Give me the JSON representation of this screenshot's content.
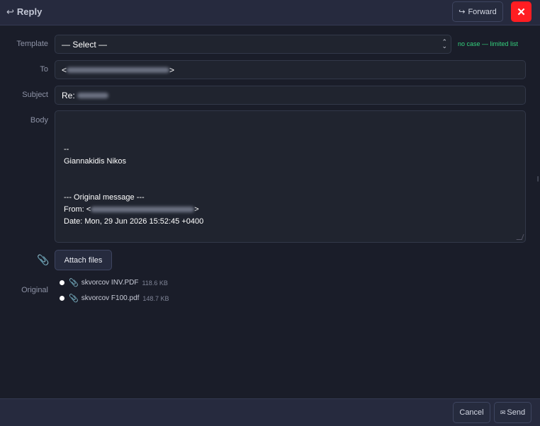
{
  "header": {
    "title": "Reply",
    "reply_icon": "↩",
    "forward_label": "Forward",
    "forward_icon": "↪",
    "close_icon": "✕"
  },
  "form": {
    "template": {
      "label": "Template",
      "value": "— Select —",
      "hint": "no case — limited list"
    },
    "to": {
      "label": "To",
      "prefix": "<",
      "suffix": ">"
    },
    "subject": {
      "label": "Subject",
      "prefix": "Re:"
    },
    "body": {
      "label": "Body",
      "signature_sep": "--",
      "signature_name": "Giannakidis Nikos",
      "orig_header": "--- Original message ---",
      "from_prefix": "From: <",
      "from_suffix": ">",
      "date_line": "Date: Mon, 29 Jun 2026 15:52:45 +0400"
    }
  },
  "attachments": {
    "button_label": "Attach files",
    "original_label": "Original",
    "items": [
      {
        "name": "skvorcov INV.PDF",
        "size": "118.6 KB"
      },
      {
        "name": "skvorcov F100.pdf",
        "size": "148.7 KB"
      }
    ]
  },
  "footer": {
    "cancel_label": "Cancel",
    "send_label": "Send",
    "send_icon": "✉"
  }
}
